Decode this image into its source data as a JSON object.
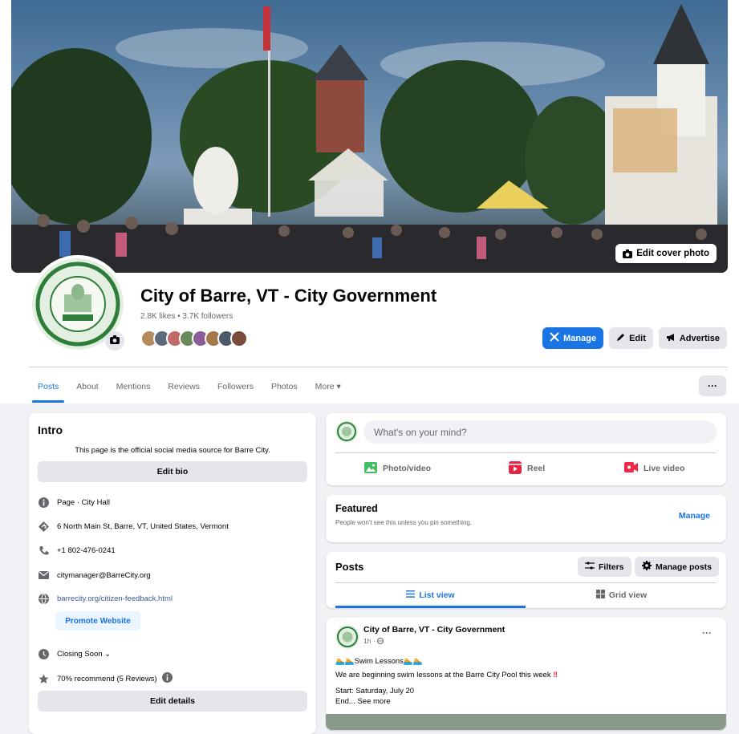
{
  "cover": {
    "edit_label": "Edit cover photo"
  },
  "profile": {
    "name": "City of Barre, VT - City Government",
    "stats": "2.8K likes • 3.7K followers"
  },
  "actions": {
    "manage": "Manage",
    "edit": "Edit",
    "advertise": "Advertise"
  },
  "tabs": [
    "Posts",
    "About",
    "Mentions",
    "Reviews",
    "Followers",
    "Photos",
    "More ▾"
  ],
  "intro": {
    "title": "Intro",
    "bio": "This page is the official social media source for Barre City.",
    "edit_bio": "Edit bio",
    "page_type": "Page · City Hall",
    "address": "6 North Main St, Barre, VT, United States, Vermont",
    "phone": "+1 802-476-0241",
    "email": "citymanager@BarreCity.org",
    "website": "barrecity.org/citizen-feedback.html",
    "promote": "Promote Website",
    "hours": "Closing Soon ⌄",
    "rating": "70% recommend (5 Reviews)",
    "edit_details": "Edit details"
  },
  "composer": {
    "placeholder": "What's on your mind?",
    "photo": "Photo/video",
    "reel": "Reel",
    "live": "Live video"
  },
  "featured": {
    "title": "Featured",
    "subtitle": "People won't see this unless you pin something.",
    "manage": "Manage"
  },
  "posts": {
    "title": "Posts",
    "filters": "Filters",
    "manage_posts": "Manage posts",
    "list_view": "List view",
    "grid_view": "Grid view"
  },
  "post": {
    "author": "City of Barre, VT - City Government",
    "time": "1h · ",
    "line1": "Swim Lessons",
    "line2": "We are beginning swim lessons at the Barre City Pool this week",
    "line3": "Start: Saturday, July 20",
    "line4": "End... See more"
  },
  "colors": {
    "accent": "#1b74e4",
    "background": "#f0f2f5"
  },
  "icons": [
    "camera-icon",
    "manage-icon",
    "pencil-icon",
    "megaphone-icon",
    "info-icon",
    "pin-icon",
    "phone-icon",
    "email-icon",
    "globe-icon",
    "clock-icon",
    "star-icon",
    "photo-icon",
    "reel-icon",
    "live-icon",
    "filters-icon",
    "gear-icon",
    "list-icon",
    "grid-icon",
    "globe-small-icon"
  ]
}
